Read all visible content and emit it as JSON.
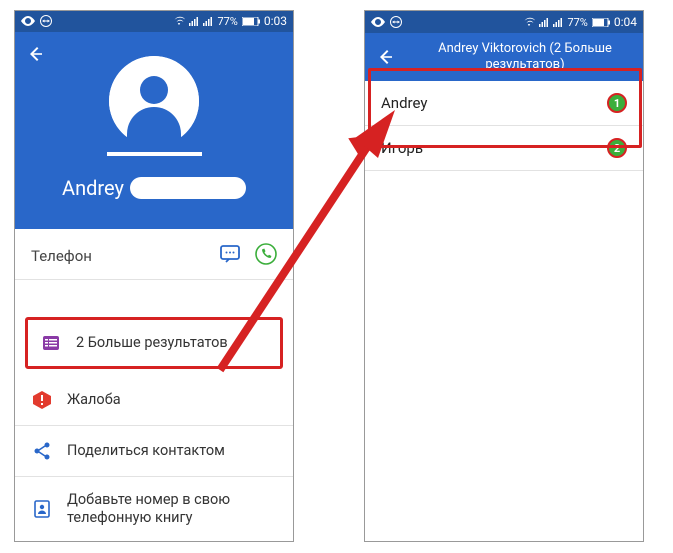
{
  "status": {
    "battery": "77%",
    "time_left": "0:03",
    "time_right": "0:04"
  },
  "left_screen": {
    "contact_name": "Andrey",
    "section_phone": "Телефон",
    "more_results": "2 Больше результатов",
    "complaint": "Жалоба",
    "share": "Поделиться контактом",
    "add_to_book": "Добавьте номер в свою телефонную книгу"
  },
  "right_screen": {
    "header_title": "Andrey Viktorovich (2 Больше результатов)",
    "results": [
      {
        "name": "Andrey",
        "num": "1"
      },
      {
        "name": "Игорь",
        "num": "2"
      }
    ]
  }
}
